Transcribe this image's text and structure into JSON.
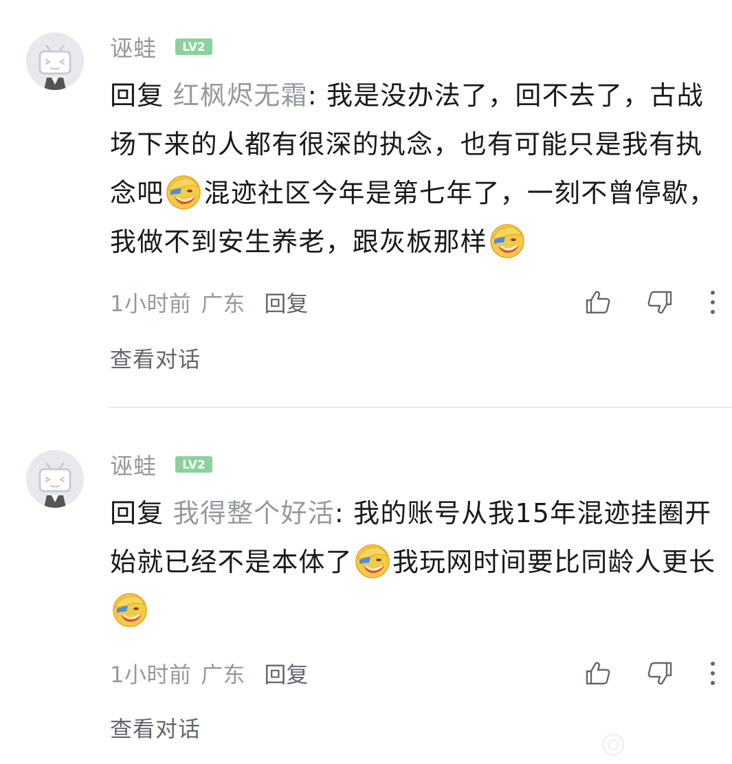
{
  "comments": [
    {
      "username": "诬蛙",
      "level": "LV2",
      "reply_prefix": "回复 ",
      "reply_target": "红枫烬无霜",
      "text_parts": [
        ": 我是没办法了，回不去了，古战场下来的人都有很深的执念，也有可能只是我有执念吧",
        "混迹社区今年是第七年了，一刻不曾停歇，我做不到安生养老，跟灰板那样"
      ],
      "emoji": "laughing-cry-emoji",
      "time": "1小时前",
      "location": "广东",
      "reply_label": "回复",
      "view_conversation": "查看对话"
    },
    {
      "username": "诬蛙",
      "level": "LV2",
      "reply_prefix": "回复 ",
      "reply_target": "我得整个好活",
      "text_parts": [
        ": 我的账号从我15年混迹挂圈开始就已经不是本体了",
        "我玩网时间要比同龄人更长"
      ],
      "emoji": "laughing-cry-emoji",
      "time": "1小时前",
      "location": "广东",
      "reply_label": "回复",
      "view_conversation": "查看对话"
    }
  ],
  "colors": {
    "text_primary": "#18191c",
    "text_secondary": "#9499a0",
    "text_tertiary": "#61666d",
    "level_badge": "#8bd29b",
    "divider": "#e8eaed",
    "avatar_bg": "#e7e9ed"
  },
  "icons": [
    "like-icon",
    "dislike-icon",
    "more-vertical-icon",
    "level-badge-icon",
    "default-avatar-icon"
  ]
}
